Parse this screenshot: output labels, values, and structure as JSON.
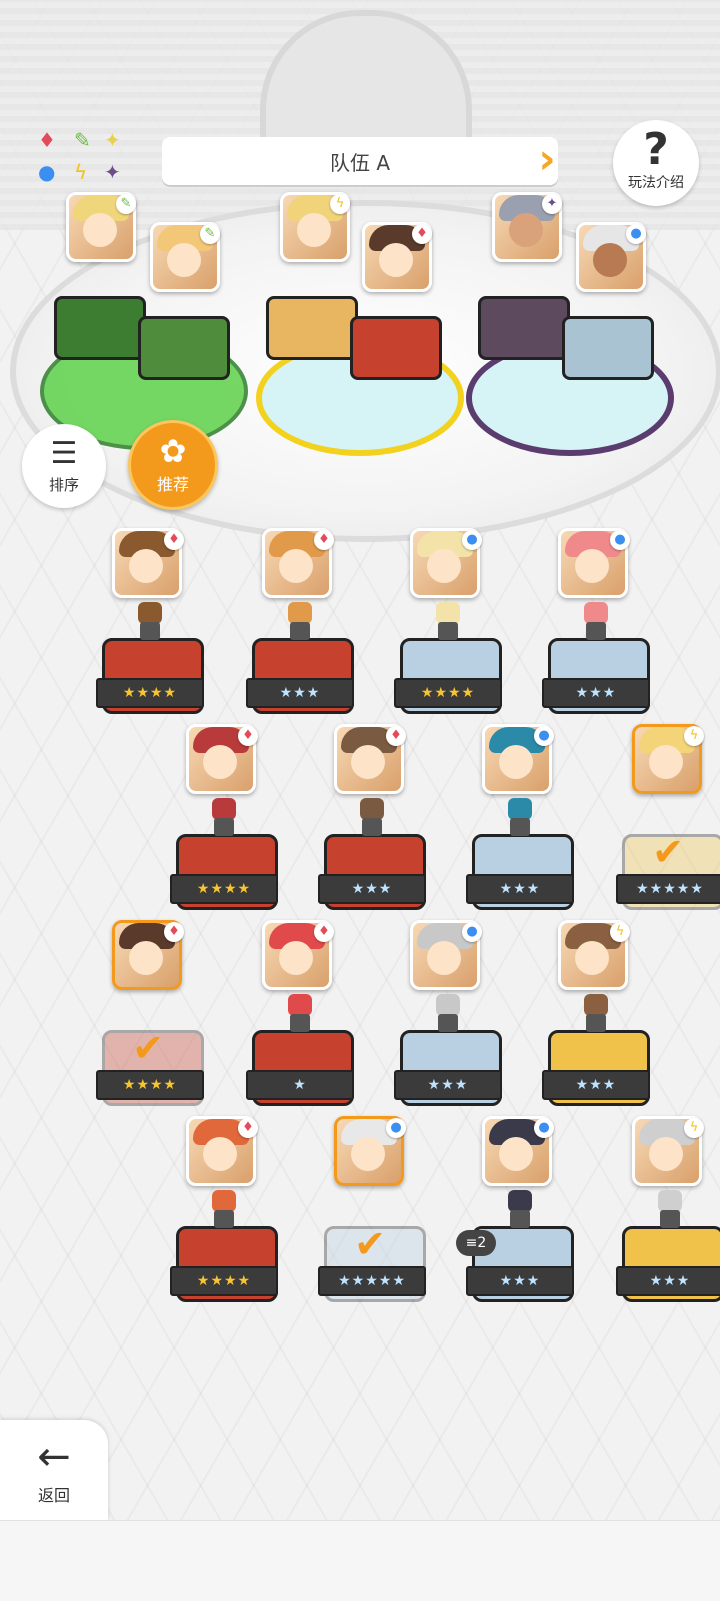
{
  "header": {
    "team_title": "队伍 A"
  },
  "help": {
    "icon": "?",
    "label": "玩法介绍"
  },
  "legend": {
    "symbols": [
      {
        "glyph": "♦",
        "color": "#e44b5a",
        "name": "fire-element"
      },
      {
        "glyph": "✎",
        "color": "#6abf3a",
        "name": "wind-element"
      },
      {
        "glyph": "✦",
        "color": "#e8d24a",
        "name": "light-element"
      },
      {
        "glyph": "●",
        "color": "#3a8ff0",
        "name": "water-element"
      },
      {
        "glyph": "ϟ",
        "color": "#f2c21e",
        "name": "thunder-element"
      },
      {
        "glyph": "✦",
        "color": "#6b4b8c",
        "name": "dark-element"
      }
    ]
  },
  "controls": {
    "sort": {
      "icon": "☰",
      "label": "排序"
    },
    "recommend": {
      "icon": "✿",
      "label": "推荐"
    },
    "back": {
      "icon": "←",
      "label": "返回"
    }
  },
  "team_slots": [
    {
      "group": "green",
      "color": "#5ed14a",
      "heroes": [
        "wind-blonde",
        "wind-blonde-2"
      ]
    },
    {
      "group": "yellow",
      "color": "#f2d21e",
      "heroes": [
        "thunder-blonde",
        "fire-ninja"
      ]
    },
    {
      "group": "purple",
      "color": "#5a3d6e",
      "heroes": [
        "dark-warrior",
        "water-girl"
      ]
    }
  ],
  "roster": [
    {
      "stars": "★★★★",
      "element": "♦",
      "selected": false
    },
    {
      "stars": "★★★",
      "element": "♦",
      "selected": false
    },
    {
      "stars": "★★★★",
      "element": "●",
      "selected": false
    },
    {
      "stars": "★★★",
      "element": "●",
      "selected": false
    },
    {
      "stars": "★★★★",
      "element": "♦",
      "selected": false
    },
    {
      "stars": "★★★",
      "element": "♦",
      "selected": false
    },
    {
      "stars": "★★★",
      "element": "●",
      "selected": false
    },
    {
      "stars": "★★★★★",
      "element": "ϟ",
      "selected": true
    },
    {
      "stars": "★★★★",
      "element": "♦",
      "selected": true
    },
    {
      "stars": "★",
      "element": "♦",
      "selected": false
    },
    {
      "stars": "★★★",
      "element": "●",
      "selected": false
    },
    {
      "stars": "★★★",
      "element": "ϟ",
      "selected": false
    },
    {
      "stars": "★★★★",
      "element": "♦",
      "selected": false
    },
    {
      "stars": "★★★★★",
      "element": "●",
      "selected": true
    },
    {
      "stars": "★★★",
      "element": "●",
      "selected": false,
      "count": "2"
    },
    {
      "stars": "★★★",
      "element": "ϟ",
      "selected": false
    }
  ],
  "colors": {
    "accent": "#f39a1c",
    "star_gold": "#f7c531",
    "star_blue": "#bfe3ff",
    "fire": "#c7412f",
    "water": "#b9cfe2",
    "thunder": "#f0c24a"
  }
}
